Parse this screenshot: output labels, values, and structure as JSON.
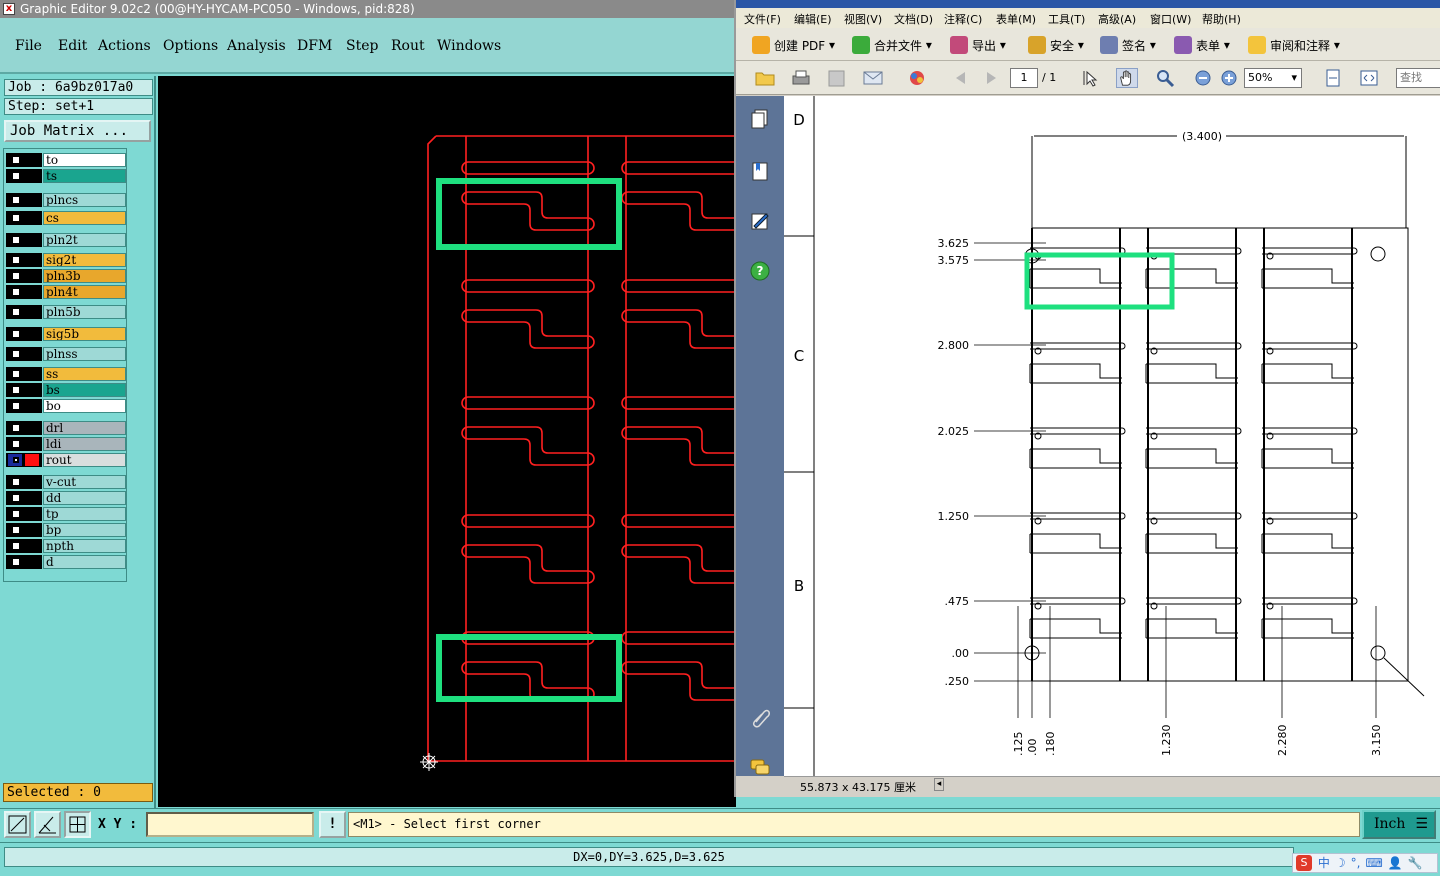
{
  "graphic_editor": {
    "title": "Graphic Editor 9.02c2 (00@HY-HYCAM-PC050 - Windows, pid:828)",
    "menu": [
      "File",
      "Edit",
      "Actions",
      "Options",
      "Analysis",
      "DFM",
      "Step",
      "Rout",
      "Windows"
    ],
    "job_label": "Job : 6a9bz017a0",
    "step_label": "Step: set+1",
    "job_matrix_button": "Job Matrix ...",
    "layers": [
      {
        "name": "to",
        "color": "#ffffff"
      },
      {
        "name": "ts",
        "color": "#1aa58f"
      },
      {
        "name": "plncs",
        "color": "#9ed9d6"
      },
      {
        "name": "cs",
        "color": "#f2bb3c"
      },
      {
        "name": "pln2t",
        "color": "#9ed9d6"
      },
      {
        "name": "sig2t",
        "color": "#f2bb3c"
      },
      {
        "name": "pln3b",
        "color": "#e8a72c"
      },
      {
        "name": "pln4t",
        "color": "#e8a72c"
      },
      {
        "name": "pln5b",
        "color": "#9ed9d6"
      },
      {
        "name": "sig5b",
        "color": "#f2bb3c"
      },
      {
        "name": "plnss",
        "color": "#9ed9d6"
      },
      {
        "name": "ss",
        "color": "#f2bb3c"
      },
      {
        "name": "bs",
        "color": "#1aa58f"
      },
      {
        "name": "bo",
        "color": "#ffffff"
      },
      {
        "name": "drl",
        "color": "#a9b5bb"
      },
      {
        "name": "ldi",
        "color": "#a9b5bb"
      },
      {
        "name": "rout",
        "color": "#d9dede",
        "active": true
      },
      {
        "name": "v-cut",
        "color": "#9ed9d6"
      },
      {
        "name": "dd",
        "color": "#9ed9d6"
      },
      {
        "name": "tp",
        "color": "#9ed9d6"
      },
      {
        "name": "bp",
        "color": "#9ed9d6"
      },
      {
        "name": "npth",
        "color": "#9ed9d6"
      },
      {
        "name": "d",
        "color": "#9ed9d6"
      }
    ],
    "selected_label": "Selected : 0",
    "xy_label": "X Y :",
    "xy_value": "",
    "bang_label": "!",
    "prompt": "<M1> - Select first corner",
    "unit": "Inch",
    "status": "DX=0,DY=3.625,D=3.625",
    "highlight_color": "#1ee07f",
    "rout_color": "#ff2020"
  },
  "acrobat": {
    "menu": [
      "文件(F)",
      "编辑(E)",
      "视图(V)",
      "文档(D)",
      "注释(C)",
      "表单(M)",
      "工具(T)",
      "高级(A)",
      "窗口(W)",
      "帮助(H)"
    ],
    "toolbar": [
      "创建 PDF",
      "合并文件",
      "导出",
      "安全",
      "签名",
      "表单",
      "审阅和注释"
    ],
    "page_current": "1",
    "page_total": "/ 1",
    "zoom": "50%",
    "search_placeholder": "查找",
    "status_size": "55.873 x 43.175 厘米",
    "drawing": {
      "dimension_width": "(3.400)",
      "zone_letters": [
        "D",
        "C",
        "B"
      ],
      "y_labels": [
        "3.625",
        "3.575",
        "2.800",
        "2.025",
        "1.250",
        ".475",
        ".00",
        ".250"
      ],
      "x_labels": [
        ".125",
        ".00",
        ".180",
        "1.230",
        "2.280",
        "3.150"
      ]
    }
  },
  "tray": {
    "ime": "中",
    "items": [
      "中",
      "☽",
      "°,",
      "⌨",
      "👤",
      "🔧"
    ]
  }
}
